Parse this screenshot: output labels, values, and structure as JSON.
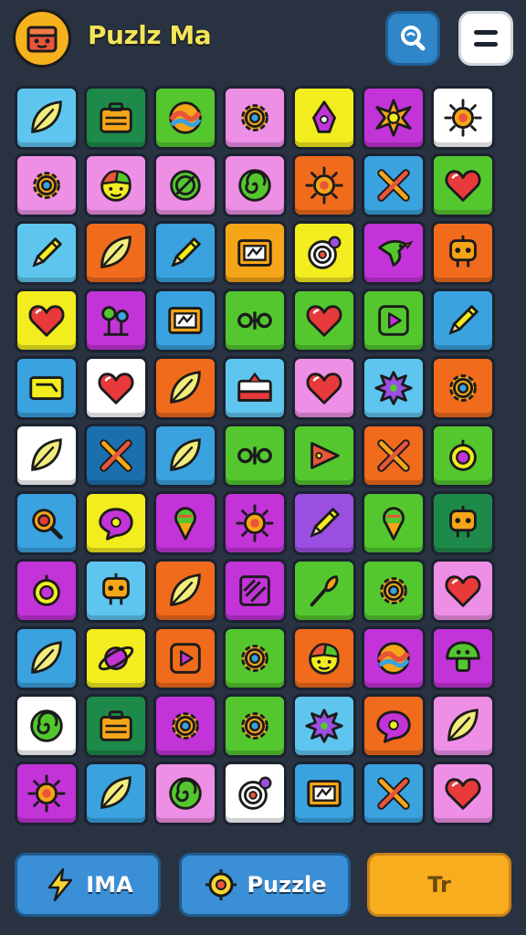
{
  "header": {
    "title": "Puzlz Ma"
  },
  "icons": {
    "logo": "treasure-chest-icon",
    "search": "search-icon",
    "menu": "menu-icon"
  },
  "grid": {
    "rows": [
      [
        {
          "bg": "#5ec6ee",
          "icon": "leaf"
        },
        {
          "bg": "#1e8a4a",
          "icon": "briefcase"
        },
        {
          "bg": "#54c72f",
          "icon": "wave"
        },
        {
          "bg": "#ee8fe6",
          "icon": "gear"
        },
        {
          "bg": "#f3ec1f",
          "icon": "pen-tip"
        },
        {
          "bg": "#c234d8",
          "icon": "star-burst"
        },
        {
          "bg": "#ffffff",
          "icon": "sun"
        }
      ],
      [
        {
          "bg": "#ee8fe6",
          "icon": "gear"
        },
        {
          "bg": "#ee8fe6",
          "icon": "face"
        },
        {
          "bg": "#ee8fe6",
          "icon": "slash-circle"
        },
        {
          "bg": "#ee8fe6",
          "icon": "spiral"
        },
        {
          "bg": "#f06b1c",
          "icon": "sun"
        },
        {
          "bg": "#3aa2df",
          "icon": "cross"
        },
        {
          "bg": "#54c72f",
          "icon": "heart"
        }
      ],
      [
        {
          "bg": "#5ec6ee",
          "icon": "pencil"
        },
        {
          "bg": "#f06b1c",
          "icon": "leaf"
        },
        {
          "bg": "#3aa2df",
          "icon": "pencil"
        },
        {
          "bg": "#f5a518",
          "icon": "board"
        },
        {
          "bg": "#f3ec1f",
          "icon": "target"
        },
        {
          "bg": "#c234d8",
          "icon": "bird"
        },
        {
          "bg": "#f06b1c",
          "icon": "robot"
        }
      ],
      [
        {
          "bg": "#f3ec1f",
          "icon": "heart"
        },
        {
          "bg": "#c234d8",
          "icon": "plant"
        },
        {
          "bg": "#3aa2df",
          "icon": "board"
        },
        {
          "bg": "#54c72f",
          "icon": "knot"
        },
        {
          "bg": "#54c72f",
          "icon": "heart"
        },
        {
          "bg": "#54c72f",
          "icon": "play"
        },
        {
          "bg": "#3aa2df",
          "icon": "pencil"
        }
      ],
      [
        {
          "bg": "#3aa2df",
          "icon": "card"
        },
        {
          "bg": "#ffffff",
          "icon": "heart"
        },
        {
          "bg": "#f06b1c",
          "icon": "leaf"
        },
        {
          "bg": "#5ec6ee",
          "icon": "flag"
        },
        {
          "bg": "#ee8fe6",
          "icon": "heart"
        },
        {
          "bg": "#5ec6ee",
          "icon": "splat"
        },
        {
          "bg": "#f06b1c",
          "icon": "gear"
        }
      ],
      [
        {
          "bg": "#ffffff",
          "icon": "leaf"
        },
        {
          "bg": "#1c6fae",
          "icon": "cross"
        },
        {
          "bg": "#3aa2df",
          "icon": "leaf"
        },
        {
          "bg": "#54c72f",
          "icon": "knot"
        },
        {
          "bg": "#54c72f",
          "icon": "triangle"
        },
        {
          "bg": "#f06b1c",
          "icon": "cross"
        },
        {
          "bg": "#54c72f",
          "icon": "ring"
        }
      ],
      [
        {
          "bg": "#3aa2df",
          "icon": "search"
        },
        {
          "bg": "#f3ec1f",
          "icon": "bubble"
        },
        {
          "bg": "#c234d8",
          "icon": "ice-cream"
        },
        {
          "bg": "#c234d8",
          "icon": "sun"
        },
        {
          "bg": "#9b4fe0",
          "icon": "pencil"
        },
        {
          "bg": "#54c72f",
          "icon": "ice-cream"
        },
        {
          "bg": "#1e8a4a",
          "icon": "robot"
        }
      ],
      [
        {
          "bg": "#c234d8",
          "icon": "ring"
        },
        {
          "bg": "#5ec6ee",
          "icon": "robot"
        },
        {
          "bg": "#f06b1c",
          "icon": "leaf"
        },
        {
          "bg": "#c234d8",
          "icon": "slash-square"
        },
        {
          "bg": "#54c72f",
          "icon": "brush"
        },
        {
          "bg": "#54c72f",
          "icon": "gear"
        },
        {
          "bg": "#ee8fe6",
          "icon": "heart"
        }
      ],
      [
        {
          "bg": "#3aa2df",
          "icon": "leaf"
        },
        {
          "bg": "#f3ec1f",
          "icon": "planet"
        },
        {
          "bg": "#f06b1c",
          "icon": "play"
        },
        {
          "bg": "#54c72f",
          "icon": "gear"
        },
        {
          "bg": "#f06b1c",
          "icon": "face"
        },
        {
          "bg": "#c234d8",
          "icon": "wave"
        },
        {
          "bg": "#c234d8",
          "icon": "mushroom"
        }
      ],
      [
        {
          "bg": "#ffffff",
          "icon": "spiral"
        },
        {
          "bg": "#1e8a4a",
          "icon": "briefcase"
        },
        {
          "bg": "#c234d8",
          "icon": "gear"
        },
        {
          "bg": "#54c72f",
          "icon": "gear"
        },
        {
          "bg": "#5ec6ee",
          "icon": "splat"
        },
        {
          "bg": "#f06b1c",
          "icon": "bubble"
        },
        {
          "bg": "#ee8fe6",
          "icon": "leaf"
        }
      ],
      [
        {
          "bg": "#c234d8",
          "icon": "sun"
        },
        {
          "bg": "#3aa2df",
          "icon": "leaf"
        },
        {
          "bg": "#ee8fe6",
          "icon": "spiral"
        },
        {
          "bg": "#ffffff",
          "icon": "target"
        },
        {
          "bg": "#3aa2df",
          "icon": "board"
        },
        {
          "bg": "#3aa2df",
          "icon": "cross"
        },
        {
          "bg": "#ee8fe6",
          "icon": "heart"
        }
      ]
    ]
  },
  "bottom_bar": {
    "btn1_label": "IMA",
    "btn1_icon": "lightning-icon",
    "btn2_label": "Puzzle",
    "btn2_icon": "puzzle-icon",
    "btn3_label": "Tr"
  }
}
